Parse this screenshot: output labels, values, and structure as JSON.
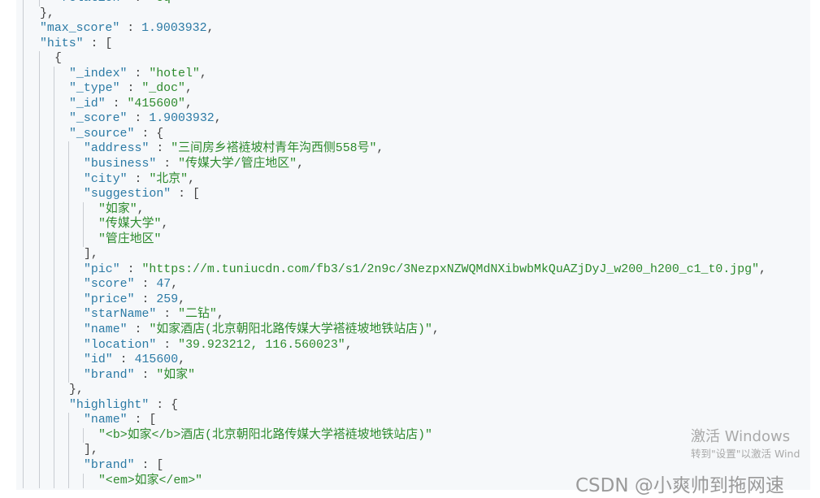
{
  "lines": [
    {
      "level": 2,
      "tokens": [
        {
          "c": "key",
          "v": "\"relation\""
        },
        {
          "c": "p",
          "v": " : "
        },
        {
          "c": "str",
          "v": "\"eq\""
        }
      ]
    },
    {
      "level": 1,
      "tokens": [
        {
          "c": "p",
          "v": "},"
        }
      ]
    },
    {
      "level": 1,
      "tokens": [
        {
          "c": "key",
          "v": "\"max_score\""
        },
        {
          "c": "p",
          "v": " : "
        },
        {
          "c": "num",
          "v": "1.9003932"
        },
        {
          "c": "p",
          "v": ","
        }
      ]
    },
    {
      "level": 1,
      "tokens": [
        {
          "c": "key",
          "v": "\"hits\""
        },
        {
          "c": "p",
          "v": " : ["
        }
      ]
    },
    {
      "level": 2,
      "tokens": [
        {
          "c": "p",
          "v": "{"
        }
      ]
    },
    {
      "level": 3,
      "tokens": [
        {
          "c": "key",
          "v": "\"_index\""
        },
        {
          "c": "p",
          "v": " : "
        },
        {
          "c": "str",
          "v": "\"hotel\""
        },
        {
          "c": "p",
          "v": ","
        }
      ]
    },
    {
      "level": 3,
      "tokens": [
        {
          "c": "key",
          "v": "\"_type\""
        },
        {
          "c": "p",
          "v": " : "
        },
        {
          "c": "str",
          "v": "\"_doc\""
        },
        {
          "c": "p",
          "v": ","
        }
      ]
    },
    {
      "level": 3,
      "tokens": [
        {
          "c": "key",
          "v": "\"_id\""
        },
        {
          "c": "p",
          "v": " : "
        },
        {
          "c": "str",
          "v": "\"415600\""
        },
        {
          "c": "p",
          "v": ","
        }
      ]
    },
    {
      "level": 3,
      "tokens": [
        {
          "c": "key",
          "v": "\"_score\""
        },
        {
          "c": "p",
          "v": " : "
        },
        {
          "c": "num",
          "v": "1.9003932"
        },
        {
          "c": "p",
          "v": ","
        }
      ]
    },
    {
      "level": 3,
      "tokens": [
        {
          "c": "key",
          "v": "\"_source\""
        },
        {
          "c": "p",
          "v": " : {"
        }
      ]
    },
    {
      "level": 4,
      "tokens": [
        {
          "c": "key",
          "v": "\"address\""
        },
        {
          "c": "p",
          "v": " : "
        },
        {
          "c": "str",
          "v": "\"三间房乡褡裢坡村青年沟西侧558号\""
        },
        {
          "c": "p",
          "v": ","
        }
      ]
    },
    {
      "level": 4,
      "tokens": [
        {
          "c": "key",
          "v": "\"business\""
        },
        {
          "c": "p",
          "v": " : "
        },
        {
          "c": "str",
          "v": "\"传媒大学/管庄地区\""
        },
        {
          "c": "p",
          "v": ","
        }
      ]
    },
    {
      "level": 4,
      "tokens": [
        {
          "c": "key",
          "v": "\"city\""
        },
        {
          "c": "p",
          "v": " : "
        },
        {
          "c": "str",
          "v": "\"北京\""
        },
        {
          "c": "p",
          "v": ","
        }
      ]
    },
    {
      "level": 4,
      "tokens": [
        {
          "c": "key",
          "v": "\"suggestion\""
        },
        {
          "c": "p",
          "v": " : ["
        }
      ]
    },
    {
      "level": 5,
      "tokens": [
        {
          "c": "str",
          "v": "\"如家\""
        },
        {
          "c": "p",
          "v": ","
        }
      ]
    },
    {
      "level": 5,
      "tokens": [
        {
          "c": "str",
          "v": "\"传媒大学\""
        },
        {
          "c": "p",
          "v": ","
        }
      ]
    },
    {
      "level": 5,
      "tokens": [
        {
          "c": "str",
          "v": "\"管庄地区\""
        }
      ]
    },
    {
      "level": 4,
      "tokens": [
        {
          "c": "p",
          "v": "],"
        }
      ]
    },
    {
      "level": 4,
      "tokens": [
        {
          "c": "key",
          "v": "\"pic\""
        },
        {
          "c": "p",
          "v": " : "
        },
        {
          "c": "str",
          "v": "\"https://m.tuniucdn.com/fb3/s1/2n9c/3NezpxNZWQMdNXibwbMkQuAZjDyJ_w200_h200_c1_t0.jpg\""
        },
        {
          "c": "p",
          "v": ","
        }
      ]
    },
    {
      "level": 4,
      "tokens": [
        {
          "c": "key",
          "v": "\"score\""
        },
        {
          "c": "p",
          "v": " : "
        },
        {
          "c": "num",
          "v": "47"
        },
        {
          "c": "p",
          "v": ","
        }
      ]
    },
    {
      "level": 4,
      "tokens": [
        {
          "c": "key",
          "v": "\"price\""
        },
        {
          "c": "p",
          "v": " : "
        },
        {
          "c": "num",
          "v": "259"
        },
        {
          "c": "p",
          "v": ","
        }
      ]
    },
    {
      "level": 4,
      "tokens": [
        {
          "c": "key",
          "v": "\"starName\""
        },
        {
          "c": "p",
          "v": " : "
        },
        {
          "c": "str",
          "v": "\"二钻\""
        },
        {
          "c": "p",
          "v": ","
        }
      ]
    },
    {
      "level": 4,
      "tokens": [
        {
          "c": "key",
          "v": "\"name\""
        },
        {
          "c": "p",
          "v": " : "
        },
        {
          "c": "str",
          "v": "\"如家酒店(北京朝阳北路传媒大学褡裢坡地铁站店)\""
        },
        {
          "c": "p",
          "v": ","
        }
      ]
    },
    {
      "level": 4,
      "tokens": [
        {
          "c": "key",
          "v": "\"location\""
        },
        {
          "c": "p",
          "v": " : "
        },
        {
          "c": "str",
          "v": "\"39.923212, 116.560023\""
        },
        {
          "c": "p",
          "v": ","
        }
      ]
    },
    {
      "level": 4,
      "tokens": [
        {
          "c": "key",
          "v": "\"id\""
        },
        {
          "c": "p",
          "v": " : "
        },
        {
          "c": "num",
          "v": "415600"
        },
        {
          "c": "p",
          "v": ","
        }
      ]
    },
    {
      "level": 4,
      "tokens": [
        {
          "c": "key",
          "v": "\"brand\""
        },
        {
          "c": "p",
          "v": " : "
        },
        {
          "c": "str",
          "v": "\"如家\""
        }
      ]
    },
    {
      "level": 3,
      "tokens": [
        {
          "c": "p",
          "v": "},"
        }
      ]
    },
    {
      "level": 3,
      "tokens": [
        {
          "c": "key",
          "v": "\"highlight\""
        },
        {
          "c": "p",
          "v": " : {"
        }
      ]
    },
    {
      "level": 4,
      "tokens": [
        {
          "c": "key",
          "v": "\"name\""
        },
        {
          "c": "p",
          "v": " : ["
        }
      ]
    },
    {
      "level": 5,
      "tokens": [
        {
          "c": "str",
          "v": "\"<b>如家</b>酒店(北京朝阳北路传媒大学褡裢坡地铁站店)\""
        }
      ]
    },
    {
      "level": 4,
      "tokens": [
        {
          "c": "p",
          "v": "],"
        }
      ]
    },
    {
      "level": 4,
      "tokens": [
        {
          "c": "key",
          "v": "\"brand\""
        },
        {
          "c": "p",
          "v": " : ["
        }
      ]
    },
    {
      "level": 5,
      "tokens": [
        {
          "c": "str",
          "v": "\"<em>如家</em>\""
        }
      ]
    }
  ],
  "watermarks": {
    "activate_title": "激活 Windows",
    "activate_sub": "转到\"设置\"以激活 Wind",
    "csdn": "CSDN @小爽帅到拖网速"
  },
  "colors": {
    "key": "#2b7aa5",
    "string": "#2d8a2d",
    "background": "#f6f8fa"
  }
}
